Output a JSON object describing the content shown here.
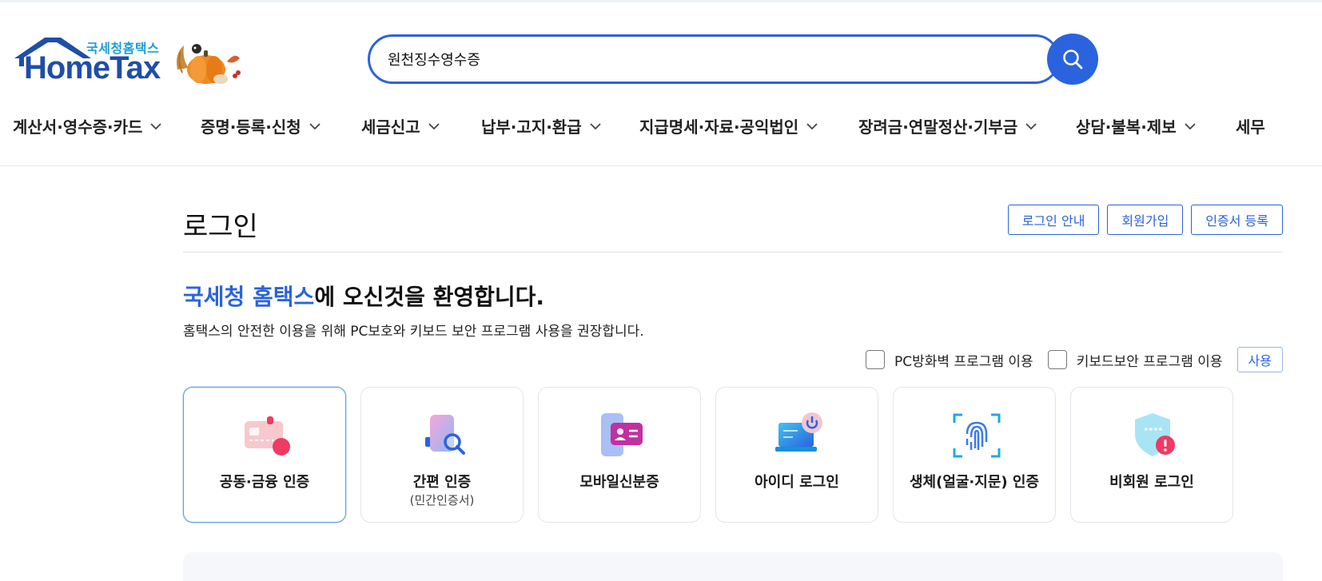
{
  "header": {
    "logo": {
      "subtitle": "국세청홈택스",
      "title": "HomeTax"
    },
    "search": {
      "value": "원천징수영수증",
      "placeholder": ""
    },
    "nav": [
      {
        "label": "계산서·영수증·카드"
      },
      {
        "label": "증명·등록·신청"
      },
      {
        "label": "세금신고"
      },
      {
        "label": "납부·고지·환급"
      },
      {
        "label": "지급명세·자료·공익법인"
      },
      {
        "label": "장려금·연말정산·기부금"
      },
      {
        "label": "상담·불복·제보"
      },
      {
        "label": "세무"
      }
    ]
  },
  "main": {
    "page_title": "로그인",
    "buttons": {
      "login_guide": "로그인 안내",
      "signup": "회원가입",
      "cert_register": "인증서 등록"
    },
    "welcome": {
      "accent": "국세청 홈택스",
      "rest": "에 오신것을 환영합니다.",
      "sub": "홈택스의 안전한 이용을 위해 PC보호와 키보드 보안 프로그램 사용을 권장합니다."
    },
    "options": {
      "firewall": "PC방화벽 프로그램 이용",
      "keyboard": "키보드보안 프로그램 이용",
      "use_button": "사용"
    },
    "login_methods": [
      {
        "label": "공동·금융 인증",
        "sublabel": "",
        "icon": "card-cert-icon"
      },
      {
        "label": "간편 인증",
        "sublabel": "(민간인증서)",
        "icon": "phone-search-icon"
      },
      {
        "label": "모바일신분증",
        "sublabel": "",
        "icon": "mobile-id-icon"
      },
      {
        "label": "아이디 로그인",
        "sublabel": "",
        "icon": "laptop-power-icon"
      },
      {
        "label": "생체(얼굴·지문) 인증",
        "sublabel": "",
        "icon": "fingerprint-icon"
      },
      {
        "label": "비회원 로그인",
        "sublabel": "",
        "icon": "shield-icon"
      }
    ]
  },
  "colors": {
    "accent": "#2a63dd",
    "logo_blue": "#1f4ea8",
    "logo_sub": "#1a9fd8"
  }
}
